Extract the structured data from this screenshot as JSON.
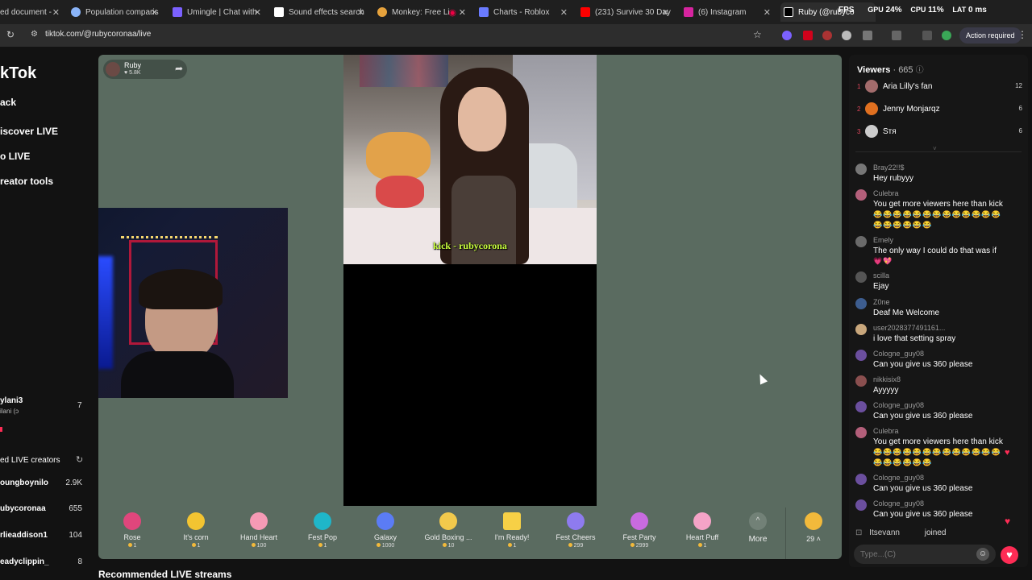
{
  "browser": {
    "tabs": [
      {
        "label": "ed document -",
        "icon_color": "#4a86e8"
      },
      {
        "label": "Population comparis",
        "icon_color": "#8ab4f8"
      },
      {
        "label": "Umingle | Chat with",
        "icon_color": "#7b61ff"
      },
      {
        "label": "Sound effects search",
        "icon_color": "#ffffff"
      },
      {
        "label": "Monkey: Free Li",
        "icon_color": "#e6a23c"
      },
      {
        "label": "Charts - Roblox",
        "icon_color": "#6a7bff"
      },
      {
        "label": "(231) Survive 30 Day",
        "icon_color": "#ff0000"
      },
      {
        "label": "(6) Instagram",
        "icon_color": "#d6249f"
      },
      {
        "label": "Ruby (@rubyco",
        "icon_color": "#ffffff"
      }
    ],
    "perf": {
      "fps": "FPS",
      "gpu_label": "GPU",
      "gpu_value": "24%",
      "cpu_label": "CPU",
      "cpu_value": "11%",
      "lat_label": "LAT",
      "lat_value": "0 ms"
    },
    "url": "tiktok.com/@rubycoronaa/live",
    "action_required": "Action required"
  },
  "nav": {
    "logo": "kTok",
    "items": [
      "ack",
      "iscover LIVE",
      "o LIVE",
      "reator tools"
    ],
    "side_user": {
      "name": "ylani3",
      "sub": "ilani (ɔ",
      "count": "7"
    },
    "recommended_header": "ed LIVE creators",
    "recommended": [
      {
        "name": "oungboynilo",
        "count": "2.9K"
      },
      {
        "name": "ubycoronaa",
        "count": "655"
      },
      {
        "name": "rlieaddison1",
        "count": "104"
      },
      {
        "name": "eadyclippin_",
        "count": "8"
      }
    ]
  },
  "stream": {
    "host_name": "Ruby",
    "host_likes": "5.8K",
    "overlay_text": "kick - rubycorona",
    "recommended_title": "Recommended LIVE streams"
  },
  "gifts": [
    {
      "name": "Rose",
      "price": "1",
      "color": "#e0467c"
    },
    {
      "name": "It's corn",
      "price": "1",
      "color": "#f3c431"
    },
    {
      "name": "Hand Heart",
      "price": "100",
      "color": "#f59ab5"
    },
    {
      "name": "Fest Pop",
      "price": "1",
      "color": "#1fb6c9"
    },
    {
      "name": "Galaxy",
      "price": "1000",
      "color": "#5b7cf5"
    },
    {
      "name": "Gold Boxing ...",
      "price": "10",
      "color": "#f2c94c"
    },
    {
      "name": "I'm Ready!",
      "price": "1",
      "color": "#f7d046"
    },
    {
      "name": "Fest Cheers",
      "price": "299",
      "color": "#8e7bef"
    },
    {
      "name": "Fest Party",
      "price": "2999",
      "color": "#c86be0"
    },
    {
      "name": "Heart Puff",
      "price": "1",
      "color": "#f5a3c7"
    }
  ],
  "gifts_more": "More",
  "coins": {
    "count": "29"
  },
  "chat": {
    "viewers_label": "Viewers",
    "viewers_count": "665",
    "top_viewers": [
      {
        "rank": "1",
        "name": "Aria Lilly's fan",
        "count": "12",
        "color": "#a36c6c"
      },
      {
        "rank": "2",
        "name": "Jenny Monjarqz",
        "count": "6",
        "color": "#e07020"
      },
      {
        "rank": "3",
        "name": "Sтя",
        "count": "6",
        "color": "#cccccc"
      }
    ],
    "messages": [
      {
        "user": "Bray22!!$",
        "text": "Hey rubyyy",
        "color": "#777777"
      },
      {
        "user": "Culebra",
        "text": "You get more viewers here than kick",
        "emojis": "😂😂😂😂😂😂😂😂😂😂😂😂😂😂😂😂😂😂😂",
        "color": "#b35f7a"
      },
      {
        "user": "Emely",
        "text": "The only way I could do that was if",
        "emojis": "💗💖",
        "color": "#6a6a6a"
      },
      {
        "user": "scilla",
        "text": "Ejay",
        "color": "#555555"
      },
      {
        "user": "Z0ne",
        "text": "Deaf Me Welcome",
        "color": "#3d5d8f"
      },
      {
        "user": "user2028377491161...",
        "text": "i love that setting spray",
        "color": "#c9a77c"
      },
      {
        "user": "Cologne_guy08",
        "text": "Can you give us 360 please",
        "color": "#6b4f9e"
      },
      {
        "user": "nikkisix8",
        "text": "Ayyyyy",
        "color": "#8a4f4f"
      },
      {
        "user": "Cologne_guy08",
        "text": "Can you give us 360 please",
        "color": "#6b4f9e"
      },
      {
        "user": "Culebra",
        "text": "You get more viewers here than kick",
        "emojis": "😂😂😂😂😂😂😂😂😂😂😂😂😂😂😂😂😂😂😂",
        "color": "#b35f7a"
      },
      {
        "user": "Cologne_guy08",
        "text": "Can you give us 360 please",
        "color": "#6b4f9e"
      },
      {
        "user": "Cologne_guy08",
        "text": "Can you give us 360 please",
        "color": "#6b4f9e"
      }
    ],
    "join_user": "Itsevann",
    "join_text": "joined",
    "input_placeholder": "Type...(C)"
  }
}
